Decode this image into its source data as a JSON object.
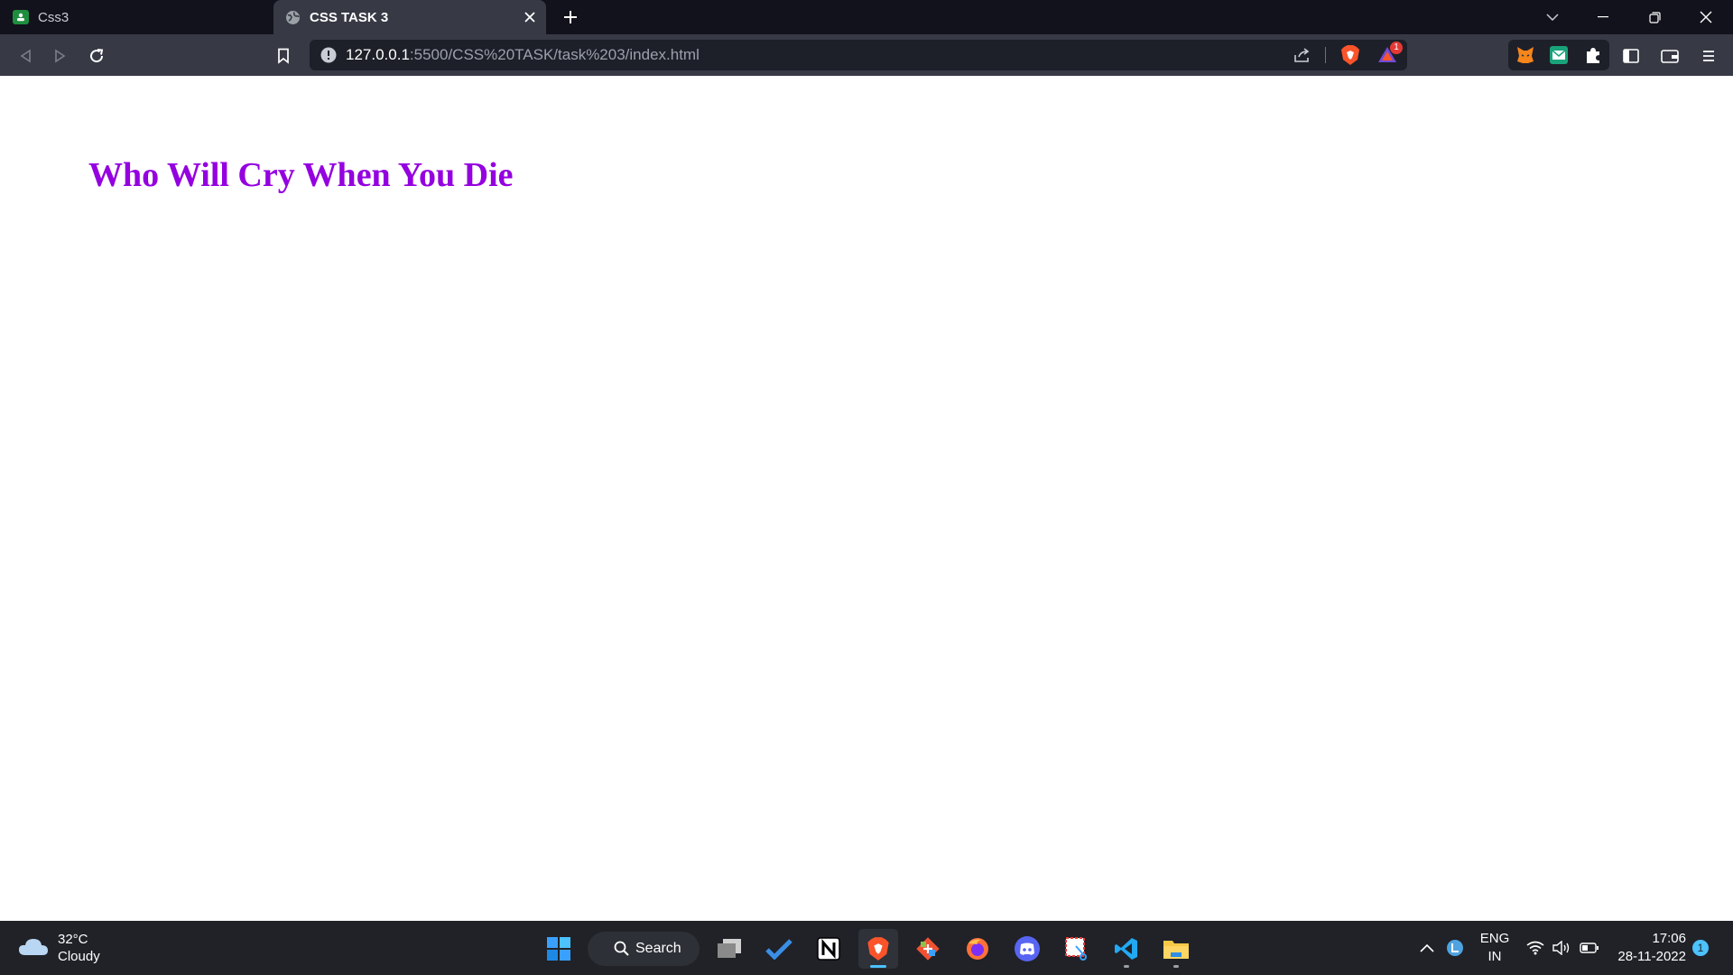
{
  "browser": {
    "tabs": [
      {
        "title": "Css3",
        "active": false
      },
      {
        "title": "CSS TASK 3",
        "active": true
      }
    ],
    "address": {
      "host": "127.0.0.1",
      "rest": ":5500/CSS%20TASK/task%203/index.html"
    },
    "shields_badge": "1",
    "colors": {
      "brave_orange": "#fb542b",
      "tab_active": "#373a45",
      "chrome_dark": "#12121c"
    }
  },
  "page": {
    "heading": "Who Will Cry When You Die",
    "heading_color": "#9400e0"
  },
  "taskbar": {
    "weather": {
      "temp": "32°C",
      "condition": "Cloudy"
    },
    "search_label": "Search",
    "apps": [
      "windows-start",
      "task-view",
      "microsoft-todo",
      "notion",
      "brave",
      "git",
      "firefox",
      "discord",
      "snipping-tool",
      "vscode",
      "file-explorer"
    ],
    "language": {
      "line1": "ENG",
      "line2": "IN"
    },
    "clock": {
      "time": "17:06",
      "date": "28-11-2022"
    },
    "notification_count": "1"
  }
}
